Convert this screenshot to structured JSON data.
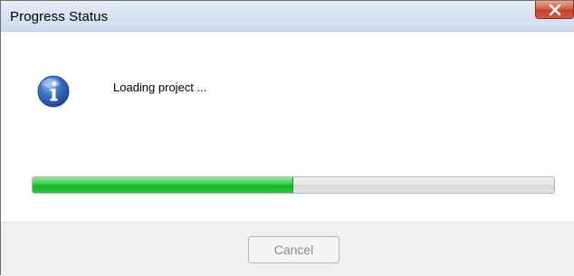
{
  "window": {
    "title": "Progress Status"
  },
  "icons": {
    "close": "close-icon",
    "info": "info-icon"
  },
  "message": {
    "text": "Loading project ..."
  },
  "progress": {
    "fraction": 0.5
  },
  "buttons": {
    "cancel_label": "Cancel",
    "cancel_enabled": false
  },
  "colors": {
    "progress_fill": "#22c233",
    "close_button": "#c94a35",
    "title_bar": "#dbe6f3"
  }
}
